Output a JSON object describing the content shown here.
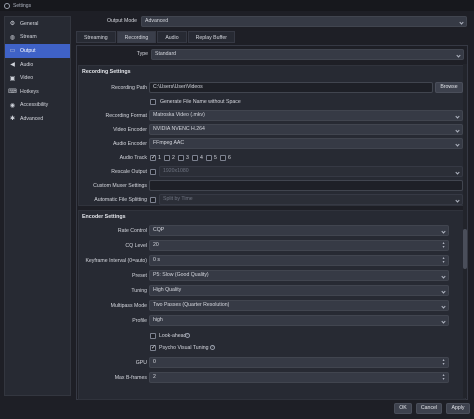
{
  "window": {
    "title": "Settings"
  },
  "sidebar": {
    "items": [
      {
        "label": "General",
        "icon": "gear-icon"
      },
      {
        "label": "Stream",
        "icon": "globe-icon"
      },
      {
        "label": "Output",
        "icon": "output-icon"
      },
      {
        "label": "Audio",
        "icon": "speaker-icon"
      },
      {
        "label": "Video",
        "icon": "monitor-icon"
      },
      {
        "label": "Hotkeys",
        "icon": "keyboard-icon"
      },
      {
        "label": "Accessibility",
        "icon": "accessibility-icon"
      },
      {
        "label": "Advanced",
        "icon": "wrench-gear-icon"
      }
    ],
    "active_index": 2
  },
  "output_mode": {
    "label": "Output Mode",
    "value": "Advanced"
  },
  "tabs": [
    {
      "label": "Streaming"
    },
    {
      "label": "Recording"
    },
    {
      "label": "Audio"
    },
    {
      "label": "Replay Buffer"
    }
  ],
  "type_row": {
    "label": "Type",
    "value": "Standard"
  },
  "recording_settings": {
    "title": "Recording Settings",
    "recording_path": {
      "label": "Recording Path",
      "value": "C:\\Users\\User\\Videos",
      "browse": "Browse"
    },
    "no_space": {
      "label": "Generate File Name without Space",
      "checked": false
    },
    "recording_format": {
      "label": "Recording Format",
      "value": "Matroska Video (.mkv)"
    },
    "video_encoder": {
      "label": "Video Encoder",
      "value": "NVIDIA NVENC H.264"
    },
    "audio_encoder": {
      "label": "Audio Encoder",
      "value": "FFmpeg AAC"
    },
    "audio_track": {
      "label": "Audio Track",
      "tracks": [
        "1",
        "2",
        "3",
        "4",
        "5",
        "6"
      ],
      "checked": [
        true,
        false,
        false,
        false,
        false,
        false
      ]
    },
    "rescale_output": {
      "label": "Rescale Output",
      "value": "1920x1080"
    },
    "custom_muxer": {
      "label": "Custom Muxer Settings",
      "value": ""
    },
    "auto_split": {
      "label": "Automatic File Splitting",
      "value": "Split by Time"
    }
  },
  "encoder_settings": {
    "title": "Encoder Settings",
    "rate_control": {
      "label": "Rate Control",
      "value": "CQP"
    },
    "cq_level": {
      "label": "CQ Level",
      "value": "20"
    },
    "keyframe_interval": {
      "label": "Keyframe Interval (0=auto)",
      "value": "0 s"
    },
    "preset": {
      "label": "Preset",
      "value": "P5: Slow (Good Quality)"
    },
    "tuning": {
      "label": "Tuning",
      "value": "High Quality"
    },
    "multipass": {
      "label": "Multipass Mode",
      "value": "Two Passes (Quarter Resolution)"
    },
    "profile": {
      "label": "Profile",
      "value": "high"
    },
    "look_ahead": {
      "label": "Look-ahead",
      "checked": false
    },
    "psycho_visual": {
      "label": "Psycho Visual Tuning",
      "checked": true
    },
    "gpu": {
      "label": "GPU",
      "value": "0"
    },
    "max_bframes": {
      "label": "Max B-frames",
      "value": "2"
    }
  },
  "footer": {
    "ok": "OK",
    "cancel": "Cancel",
    "apply": "Apply"
  }
}
